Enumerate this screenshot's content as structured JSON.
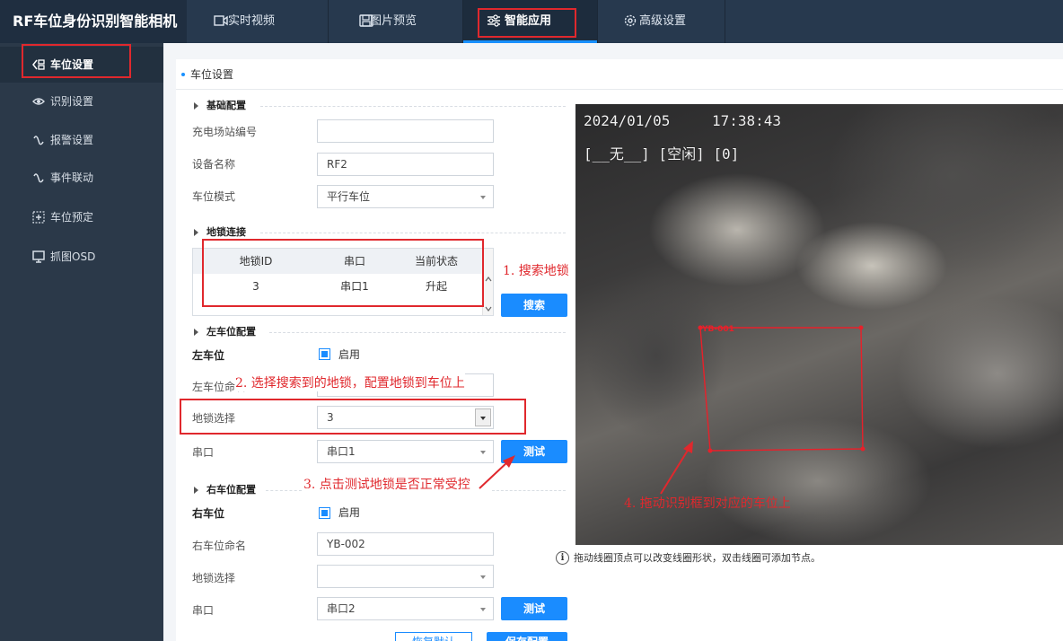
{
  "app": {
    "title": "RF车位身份识别智能相机"
  },
  "nav": {
    "tabs": [
      {
        "label": "实时视频",
        "icon": "video-icon"
      },
      {
        "label": "图片预览",
        "icon": "image-icon"
      },
      {
        "label": "智能应用",
        "icon": "sliders-icon",
        "active": true
      },
      {
        "label": "高级设置",
        "icon": "gear-icon"
      }
    ]
  },
  "sidebar": {
    "items": [
      {
        "label": "车位设置",
        "icon": "parking-icon",
        "active": true
      },
      {
        "label": "识别设置",
        "icon": "eye-icon"
      },
      {
        "label": "报警设置",
        "icon": "alarm-icon"
      },
      {
        "label": "事件联动",
        "icon": "link-icon"
      },
      {
        "label": "车位预定",
        "icon": "reserve-icon"
      },
      {
        "label": "抓图OSD",
        "icon": "monitor-icon"
      }
    ]
  },
  "breadcrumb": {
    "label": "车位设置"
  },
  "basic": {
    "title": "基础配置",
    "station_label": "充电场站编号",
    "station_value": "",
    "device_label": "设备名称",
    "device_value": "RF2",
    "mode_label": "车位模式",
    "mode_value": "平行车位"
  },
  "lock": {
    "title": "地锁连接",
    "columns": [
      "地锁ID",
      "串口",
      "当前状态"
    ],
    "rows": [
      {
        "id": "3",
        "port": "串口1",
        "status": "升起"
      }
    ],
    "search_label": "搜索"
  },
  "left": {
    "title": "左车位配置",
    "enable_label": "左车位",
    "enable_text": "启用",
    "enabled": true,
    "name_label": "左车位命名",
    "name_value": "YB-001",
    "lock_label": "地锁选择",
    "lock_value": "3",
    "port_label": "串口",
    "port_value": "串口1",
    "test_label": "测试"
  },
  "right": {
    "title": "右车位配置",
    "enable_label": "右车位",
    "enable_text": "启用",
    "enabled": true,
    "name_label": "右车位命名",
    "name_value": "YB-002",
    "lock_label": "地锁选择",
    "lock_value": "",
    "port_label": "串口",
    "port_value": "串口2",
    "test_label": "测试"
  },
  "bottom": {
    "restore_label": "恢复默认",
    "save_label": "保存配置"
  },
  "video": {
    "date": "2024/01/05",
    "time": "17:38:43",
    "status_line": "[__无__] [空闲] [0]",
    "box_label": "YB-001"
  },
  "annotations": {
    "a1": "1. 搜索地锁",
    "a2": "2. 选择搜索到的地锁，配置地锁到车位上",
    "a3": "3. 点击测试地锁是否正常受控",
    "a4": "4. 拖动识别框到对应的车位上"
  },
  "tip": {
    "text": "拖动线圈顶点可以改变线圈形状，双击线圈可添加节点。"
  },
  "colors": {
    "accent": "#1a8cff",
    "annotation": "#e0282d",
    "sidebar": "#2b3949",
    "topbar": "#27394e"
  }
}
